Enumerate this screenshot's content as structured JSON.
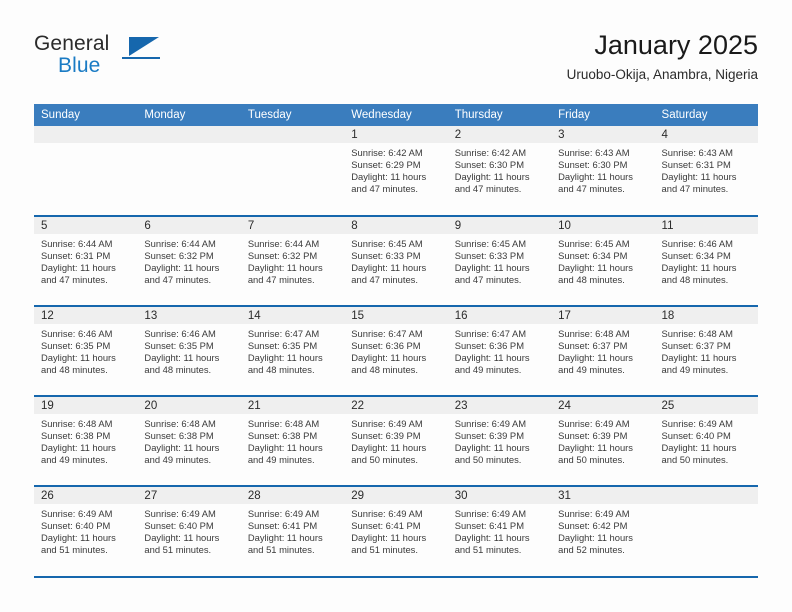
{
  "brand": {
    "word_general": "General",
    "word_blue": "Blue",
    "triangle_color": "#1667ad",
    "blue_text_color": "#1a7bc4"
  },
  "header": {
    "title": "January 2025",
    "subtitle": "Uruobo-Okija, Anambra, Nigeria",
    "header_bg": "#3a7dbe",
    "rule_color": "#1667ad",
    "daystrip_bg": "#efefef"
  },
  "weekday_headers": [
    "Sunday",
    "Monday",
    "Tuesday",
    "Wednesday",
    "Thursday",
    "Friday",
    "Saturday"
  ],
  "labels": {
    "sunrise_prefix": "Sunrise:",
    "sunset_prefix": "Sunset:",
    "daylight_prefix": "Daylight:"
  },
  "weeks": [
    [
      {
        "day": "",
        "blank": true
      },
      {
        "day": "",
        "blank": true
      },
      {
        "day": "",
        "blank": true
      },
      {
        "day": "1",
        "sunrise": "Sunrise: 6:42 AM",
        "sunset": "Sunset: 6:29 PM",
        "daylight_1": "Daylight: 11 hours",
        "daylight_2": "and 47 minutes."
      },
      {
        "day": "2",
        "sunrise": "Sunrise: 6:42 AM",
        "sunset": "Sunset: 6:30 PM",
        "daylight_1": "Daylight: 11 hours",
        "daylight_2": "and 47 minutes."
      },
      {
        "day": "3",
        "sunrise": "Sunrise: 6:43 AM",
        "sunset": "Sunset: 6:30 PM",
        "daylight_1": "Daylight: 11 hours",
        "daylight_2": "and 47 minutes."
      },
      {
        "day": "4",
        "sunrise": "Sunrise: 6:43 AM",
        "sunset": "Sunset: 6:31 PM",
        "daylight_1": "Daylight: 11 hours",
        "daylight_2": "and 47 minutes."
      }
    ],
    [
      {
        "day": "5",
        "sunrise": "Sunrise: 6:44 AM",
        "sunset": "Sunset: 6:31 PM",
        "daylight_1": "Daylight: 11 hours",
        "daylight_2": "and 47 minutes."
      },
      {
        "day": "6",
        "sunrise": "Sunrise: 6:44 AM",
        "sunset": "Sunset: 6:32 PM",
        "daylight_1": "Daylight: 11 hours",
        "daylight_2": "and 47 minutes."
      },
      {
        "day": "7",
        "sunrise": "Sunrise: 6:44 AM",
        "sunset": "Sunset: 6:32 PM",
        "daylight_1": "Daylight: 11 hours",
        "daylight_2": "and 47 minutes."
      },
      {
        "day": "8",
        "sunrise": "Sunrise: 6:45 AM",
        "sunset": "Sunset: 6:33 PM",
        "daylight_1": "Daylight: 11 hours",
        "daylight_2": "and 47 minutes."
      },
      {
        "day": "9",
        "sunrise": "Sunrise: 6:45 AM",
        "sunset": "Sunset: 6:33 PM",
        "daylight_1": "Daylight: 11 hours",
        "daylight_2": "and 47 minutes."
      },
      {
        "day": "10",
        "sunrise": "Sunrise: 6:45 AM",
        "sunset": "Sunset: 6:34 PM",
        "daylight_1": "Daylight: 11 hours",
        "daylight_2": "and 48 minutes."
      },
      {
        "day": "11",
        "sunrise": "Sunrise: 6:46 AM",
        "sunset": "Sunset: 6:34 PM",
        "daylight_1": "Daylight: 11 hours",
        "daylight_2": "and 48 minutes."
      }
    ],
    [
      {
        "day": "12",
        "sunrise": "Sunrise: 6:46 AM",
        "sunset": "Sunset: 6:35 PM",
        "daylight_1": "Daylight: 11 hours",
        "daylight_2": "and 48 minutes."
      },
      {
        "day": "13",
        "sunrise": "Sunrise: 6:46 AM",
        "sunset": "Sunset: 6:35 PM",
        "daylight_1": "Daylight: 11 hours",
        "daylight_2": "and 48 minutes."
      },
      {
        "day": "14",
        "sunrise": "Sunrise: 6:47 AM",
        "sunset": "Sunset: 6:35 PM",
        "daylight_1": "Daylight: 11 hours",
        "daylight_2": "and 48 minutes."
      },
      {
        "day": "15",
        "sunrise": "Sunrise: 6:47 AM",
        "sunset": "Sunset: 6:36 PM",
        "daylight_1": "Daylight: 11 hours",
        "daylight_2": "and 48 minutes."
      },
      {
        "day": "16",
        "sunrise": "Sunrise: 6:47 AM",
        "sunset": "Sunset: 6:36 PM",
        "daylight_1": "Daylight: 11 hours",
        "daylight_2": "and 49 minutes."
      },
      {
        "day": "17",
        "sunrise": "Sunrise: 6:48 AM",
        "sunset": "Sunset: 6:37 PM",
        "daylight_1": "Daylight: 11 hours",
        "daylight_2": "and 49 minutes."
      },
      {
        "day": "18",
        "sunrise": "Sunrise: 6:48 AM",
        "sunset": "Sunset: 6:37 PM",
        "daylight_1": "Daylight: 11 hours",
        "daylight_2": "and 49 minutes."
      }
    ],
    [
      {
        "day": "19",
        "sunrise": "Sunrise: 6:48 AM",
        "sunset": "Sunset: 6:38 PM",
        "daylight_1": "Daylight: 11 hours",
        "daylight_2": "and 49 minutes."
      },
      {
        "day": "20",
        "sunrise": "Sunrise: 6:48 AM",
        "sunset": "Sunset: 6:38 PM",
        "daylight_1": "Daylight: 11 hours",
        "daylight_2": "and 49 minutes."
      },
      {
        "day": "21",
        "sunrise": "Sunrise: 6:48 AM",
        "sunset": "Sunset: 6:38 PM",
        "daylight_1": "Daylight: 11 hours",
        "daylight_2": "and 49 minutes."
      },
      {
        "day": "22",
        "sunrise": "Sunrise: 6:49 AM",
        "sunset": "Sunset: 6:39 PM",
        "daylight_1": "Daylight: 11 hours",
        "daylight_2": "and 50 minutes."
      },
      {
        "day": "23",
        "sunrise": "Sunrise: 6:49 AM",
        "sunset": "Sunset: 6:39 PM",
        "daylight_1": "Daylight: 11 hours",
        "daylight_2": "and 50 minutes."
      },
      {
        "day": "24",
        "sunrise": "Sunrise: 6:49 AM",
        "sunset": "Sunset: 6:39 PM",
        "daylight_1": "Daylight: 11 hours",
        "daylight_2": "and 50 minutes."
      },
      {
        "day": "25",
        "sunrise": "Sunrise: 6:49 AM",
        "sunset": "Sunset: 6:40 PM",
        "daylight_1": "Daylight: 11 hours",
        "daylight_2": "and 50 minutes."
      }
    ],
    [
      {
        "day": "26",
        "sunrise": "Sunrise: 6:49 AM",
        "sunset": "Sunset: 6:40 PM",
        "daylight_1": "Daylight: 11 hours",
        "daylight_2": "and 51 minutes."
      },
      {
        "day": "27",
        "sunrise": "Sunrise: 6:49 AM",
        "sunset": "Sunset: 6:40 PM",
        "daylight_1": "Daylight: 11 hours",
        "daylight_2": "and 51 minutes."
      },
      {
        "day": "28",
        "sunrise": "Sunrise: 6:49 AM",
        "sunset": "Sunset: 6:41 PM",
        "daylight_1": "Daylight: 11 hours",
        "daylight_2": "and 51 minutes."
      },
      {
        "day": "29",
        "sunrise": "Sunrise: 6:49 AM",
        "sunset": "Sunset: 6:41 PM",
        "daylight_1": "Daylight: 11 hours",
        "daylight_2": "and 51 minutes."
      },
      {
        "day": "30",
        "sunrise": "Sunrise: 6:49 AM",
        "sunset": "Sunset: 6:41 PM",
        "daylight_1": "Daylight: 11 hours",
        "daylight_2": "and 51 minutes."
      },
      {
        "day": "31",
        "sunrise": "Sunrise: 6:49 AM",
        "sunset": "Sunset: 6:42 PM",
        "daylight_1": "Daylight: 11 hours",
        "daylight_2": "and 52 minutes."
      },
      {
        "day": "",
        "blank": true
      }
    ]
  ]
}
